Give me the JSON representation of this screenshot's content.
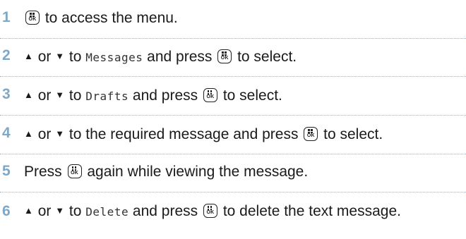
{
  "steps": [
    {
      "number": "1",
      "text_after_key": " to access the menu."
    },
    {
      "number": "2",
      "or": " or ",
      "to": " to ",
      "target": "Messages",
      "and_press": " and press ",
      "to_select": " to select."
    },
    {
      "number": "3",
      "or": " or ",
      "to": " to ",
      "target": "Drafts",
      "and_press": " and press ",
      "to_select": " to select."
    },
    {
      "number": "4",
      "or": " or ",
      "to_text": " to the required message and press ",
      "to_select": " to select."
    },
    {
      "number": "5",
      "press": "Press ",
      "text_after_key": " again while viewing the message."
    },
    {
      "number": "6",
      "or": " or ",
      "to": " to ",
      "target": "Delete",
      "and_press": " and press ",
      "to_delete": " to delete the text message."
    }
  ],
  "menu_key": {
    "label": "OK",
    "icon": "menu-ok-key-icon"
  },
  "up_arrow": "▲",
  "down_arrow": "▼",
  "colors": {
    "step_number": "#7fa8c6",
    "divider": "#8fb3cf",
    "text": "#1a1a1a"
  }
}
